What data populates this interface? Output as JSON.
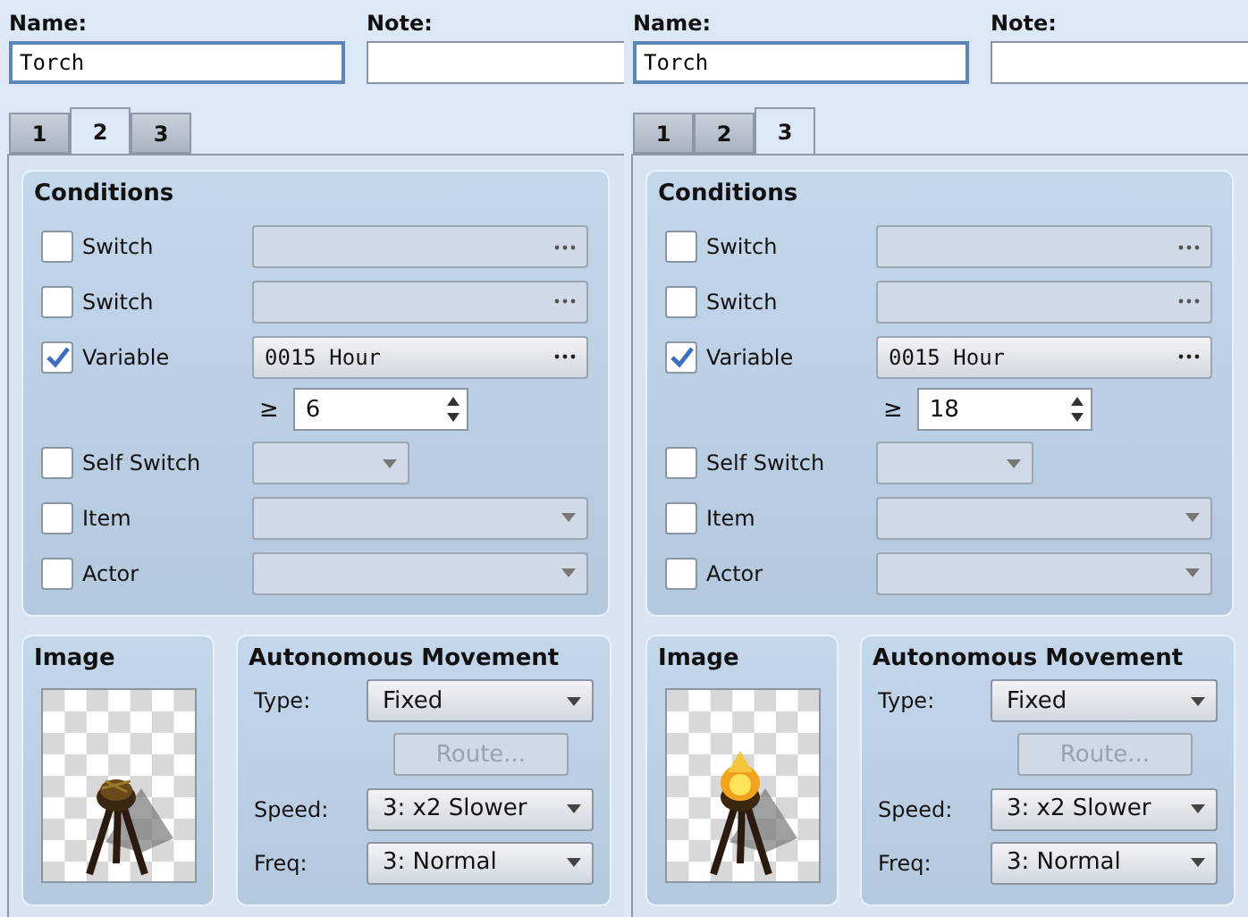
{
  "panels": [
    {
      "name_label": "Name:",
      "name_value": "Torch",
      "note_label": "Note:",
      "tabs": [
        {
          "label": "1",
          "selected": false
        },
        {
          "label": "2",
          "selected": true
        },
        {
          "label": "3",
          "selected": false
        }
      ],
      "conditions": {
        "title": "Conditions",
        "rows": [
          {
            "kind": "picker",
            "label": "Switch",
            "checked": false
          },
          {
            "kind": "picker",
            "label": "Switch",
            "checked": false
          },
          {
            "kind": "picker",
            "label": "Variable",
            "checked": true,
            "value": "0015 Hour"
          },
          {
            "kind": "spin",
            "operator": "≥",
            "value": "6"
          },
          {
            "kind": "short_dropdown",
            "label": "Self Switch",
            "checked": false
          },
          {
            "kind": "dropdown",
            "label": "Item",
            "checked": false
          },
          {
            "kind": "dropdown",
            "label": "Actor",
            "checked": false
          }
        ]
      },
      "image": {
        "title": "Image",
        "kind": "picture"
      },
      "movement": {
        "title": "Autonomous Movement",
        "type_label": "Type:",
        "type_value": "Fixed",
        "route_label": "Route...",
        "route_disabled": true,
        "speed_label": "Speed:",
        "speed_value": "3: x2 Slower",
        "freq_label": "Freq:",
        "freq_value": "3: Normal"
      }
    },
    {
      "name_label": "Name:",
      "name_value": "Torch",
      "note_label": "Note:",
      "tabs": [
        {
          "label": "1",
          "selected": false
        },
        {
          "label": "2",
          "selected": false
        },
        {
          "label": "3",
          "selected": true
        }
      ],
      "conditions": {
        "title": "Conditions",
        "rows": [
          {
            "kind": "picker",
            "label": "Switch",
            "checked": false
          },
          {
            "kind": "picker",
            "label": "Switch",
            "checked": false
          },
          {
            "kind": "picker",
            "label": "Variable",
            "checked": true,
            "value": "0015 Hour"
          },
          {
            "kind": "spin",
            "operator": "≥",
            "value": "18"
          },
          {
            "kind": "short_dropdown",
            "label": "Self Switch",
            "checked": false
          },
          {
            "kind": "dropdown",
            "label": "Item",
            "checked": false
          },
          {
            "kind": "dropdown",
            "label": "Actor",
            "checked": false
          }
        ]
      },
      "image": {
        "title": "Image",
        "kind": "picture"
      },
      "movement": {
        "title": "Autonomous Movement",
        "type_label": "Type:",
        "type_value": "Fixed",
        "route_label": "Route...",
        "route_disabled": true,
        "speed_label": "Speed:",
        "speed_value": "3: x2 Slower",
        "freq_label": "Freq:",
        "freq_value": "3: Normal"
      }
    }
  ]
}
